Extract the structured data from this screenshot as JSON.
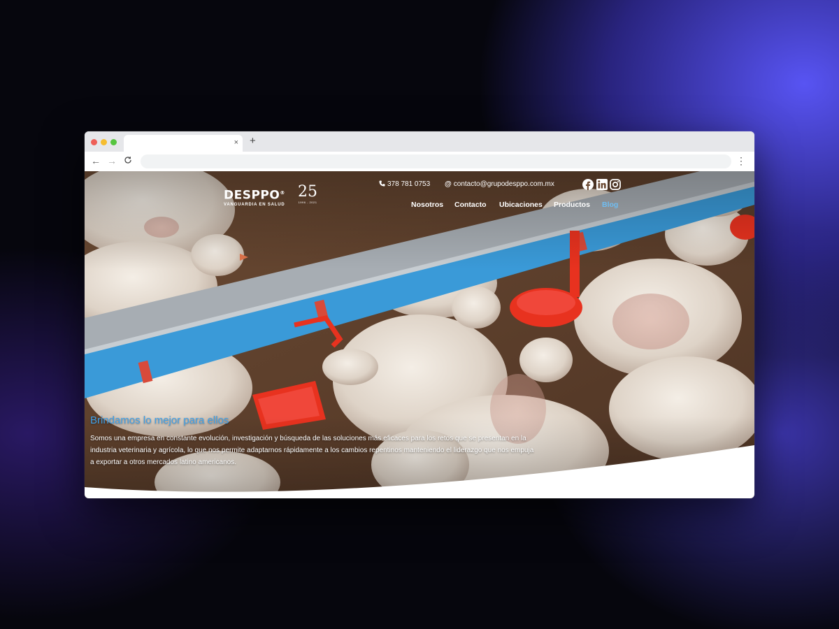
{
  "browser": {
    "tab_close": "×",
    "new_tab": "+",
    "back": "←",
    "forward": "→",
    "reload": "C",
    "menu": "⋮"
  },
  "site": {
    "logo": {
      "name": "DESPPO",
      "registered": "®",
      "tagline": "VANGUARDIA EN SALUD"
    },
    "anniversary": {
      "number": "25",
      "years": "1996 - 2021"
    },
    "phone": "378 781 0753",
    "email": "contacto@grupodesppo.com.mx",
    "social": [
      "facebook-icon",
      "linkedin-icon",
      "instagram-icon"
    ],
    "nav": {
      "nosotros": "Nosotros",
      "contacto": "Contacto",
      "ubicaciones": "Ubicaciones",
      "productos": "Productos",
      "blog": "Blog"
    },
    "hero": {
      "headline": "Brindamos lo mejor para ellos",
      "body": "Somos una empresa en constante evolución, investigación y búsqueda de las soluciones más eficaces para los retos que se presentan en la industria veterinaria y agrícola, lo que nos permite adaptarnos rápidamente a los cambios repentinos manteniendo el liderazgo que nos empuja a exportar a otros mercados latino americanos."
    }
  },
  "colors": {
    "accent_blue": "#3fa0e8",
    "feeder_red": "#e8321f",
    "pipe_blue": "#3a9ad8"
  }
}
